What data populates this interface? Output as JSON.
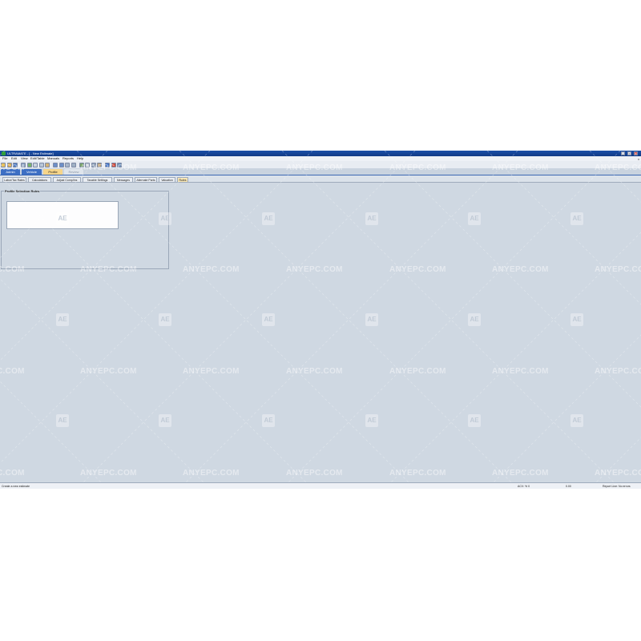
{
  "window": {
    "title": "ULTRAMATE - [ - New Estimate]",
    "min": "_",
    "max": "▫",
    "close": "x"
  },
  "menu": [
    {
      "label": "File"
    },
    {
      "label": "Edit"
    },
    {
      "label": "View"
    },
    {
      "label": "Edit/Table"
    },
    {
      "label": "Manuals"
    },
    {
      "label": "Reports"
    },
    {
      "label": "Help"
    }
  ],
  "menu_close": "x",
  "toolbar_icons": [
    "new-icon",
    "open-icon",
    "save-icon",
    "print-icon",
    "print-preview-icon",
    "cut-icon",
    "copy-icon",
    "paste-icon",
    "undo-icon",
    "redo-icon",
    "find-icon",
    "calculator-icon",
    "graphics-icon",
    "mail-icon",
    "settings-icon",
    "tools-icon",
    "help-icon",
    "delete-icon",
    "about-icon"
  ],
  "main_tabs": [
    {
      "label": "Admin",
      "state": "blue"
    },
    {
      "label": "Vehicle",
      "state": "blue"
    },
    {
      "label": "Profile",
      "state": "active"
    },
    {
      "label": "Review",
      "state": "dim"
    }
  ],
  "sub_tabs": [
    {
      "label": "Labor/Tax Rates"
    },
    {
      "label": "Calculations"
    },
    {
      "label": "Adjust Comp/Ins"
    },
    {
      "label": "Taxable Settings"
    },
    {
      "label": "Messages"
    },
    {
      "label": "Alternate Parts"
    },
    {
      "label": "Valuation"
    },
    {
      "label": "Rules"
    }
  ],
  "active_sub_tab": "Rules",
  "group": {
    "title": "Profile Selection Rules"
  },
  "status": {
    "left": "Create a new estimate",
    "mid1": "ACV: % 0",
    "mid2": "0.00",
    "right": "Report Line: No errors"
  },
  "watermark": {
    "text": "ANYEPC.COM",
    "logo": "AE"
  }
}
